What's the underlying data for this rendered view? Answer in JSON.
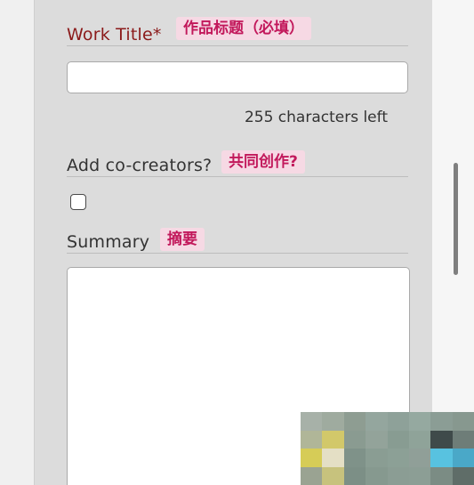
{
  "form": {
    "work_title": {
      "label": "Work Title*",
      "translation": "作品标题（必填）",
      "value": "",
      "counter": "255 characters left"
    },
    "co_creators": {
      "label": "Add co-creators?",
      "translation": "共同创作?",
      "checked": false
    },
    "summary": {
      "label": "Summary",
      "translation": "摘要",
      "value": ""
    }
  },
  "colors": {
    "panel_bg": "#dcdcdc",
    "required_label": "#8b1a1a",
    "label_text": "#333333",
    "tag_bg": "#f6d9e4",
    "tag_text": "#c2185b"
  }
}
